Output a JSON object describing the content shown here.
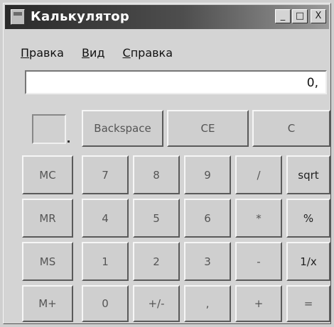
{
  "window": {
    "title": "Калькулятор"
  },
  "titlebar_buttons": {
    "minimize": "_",
    "maximize": "□",
    "close": "X"
  },
  "menu": [
    {
      "first": "П",
      "rest": "равка"
    },
    {
      "first": "В",
      "rest": "ид"
    },
    {
      "first": "С",
      "rest": "правка"
    }
  ],
  "display": {
    "value": "0,"
  },
  "top_row": {
    "backspace": "Backspace",
    "ce": "CE",
    "c": "C"
  },
  "memory": {
    "mc": "MC",
    "mr": "MR",
    "ms": "MS",
    "mplus": "M+"
  },
  "keys": {
    "row1": [
      "7",
      "8",
      "9",
      "/",
      "sqrt"
    ],
    "row2": [
      "4",
      "5",
      "6",
      "*",
      "%"
    ],
    "row3": [
      "1",
      "2",
      "3",
      "-",
      "1/x"
    ],
    "row4": [
      "0",
      "+/-",
      ",",
      "+",
      "="
    ]
  }
}
